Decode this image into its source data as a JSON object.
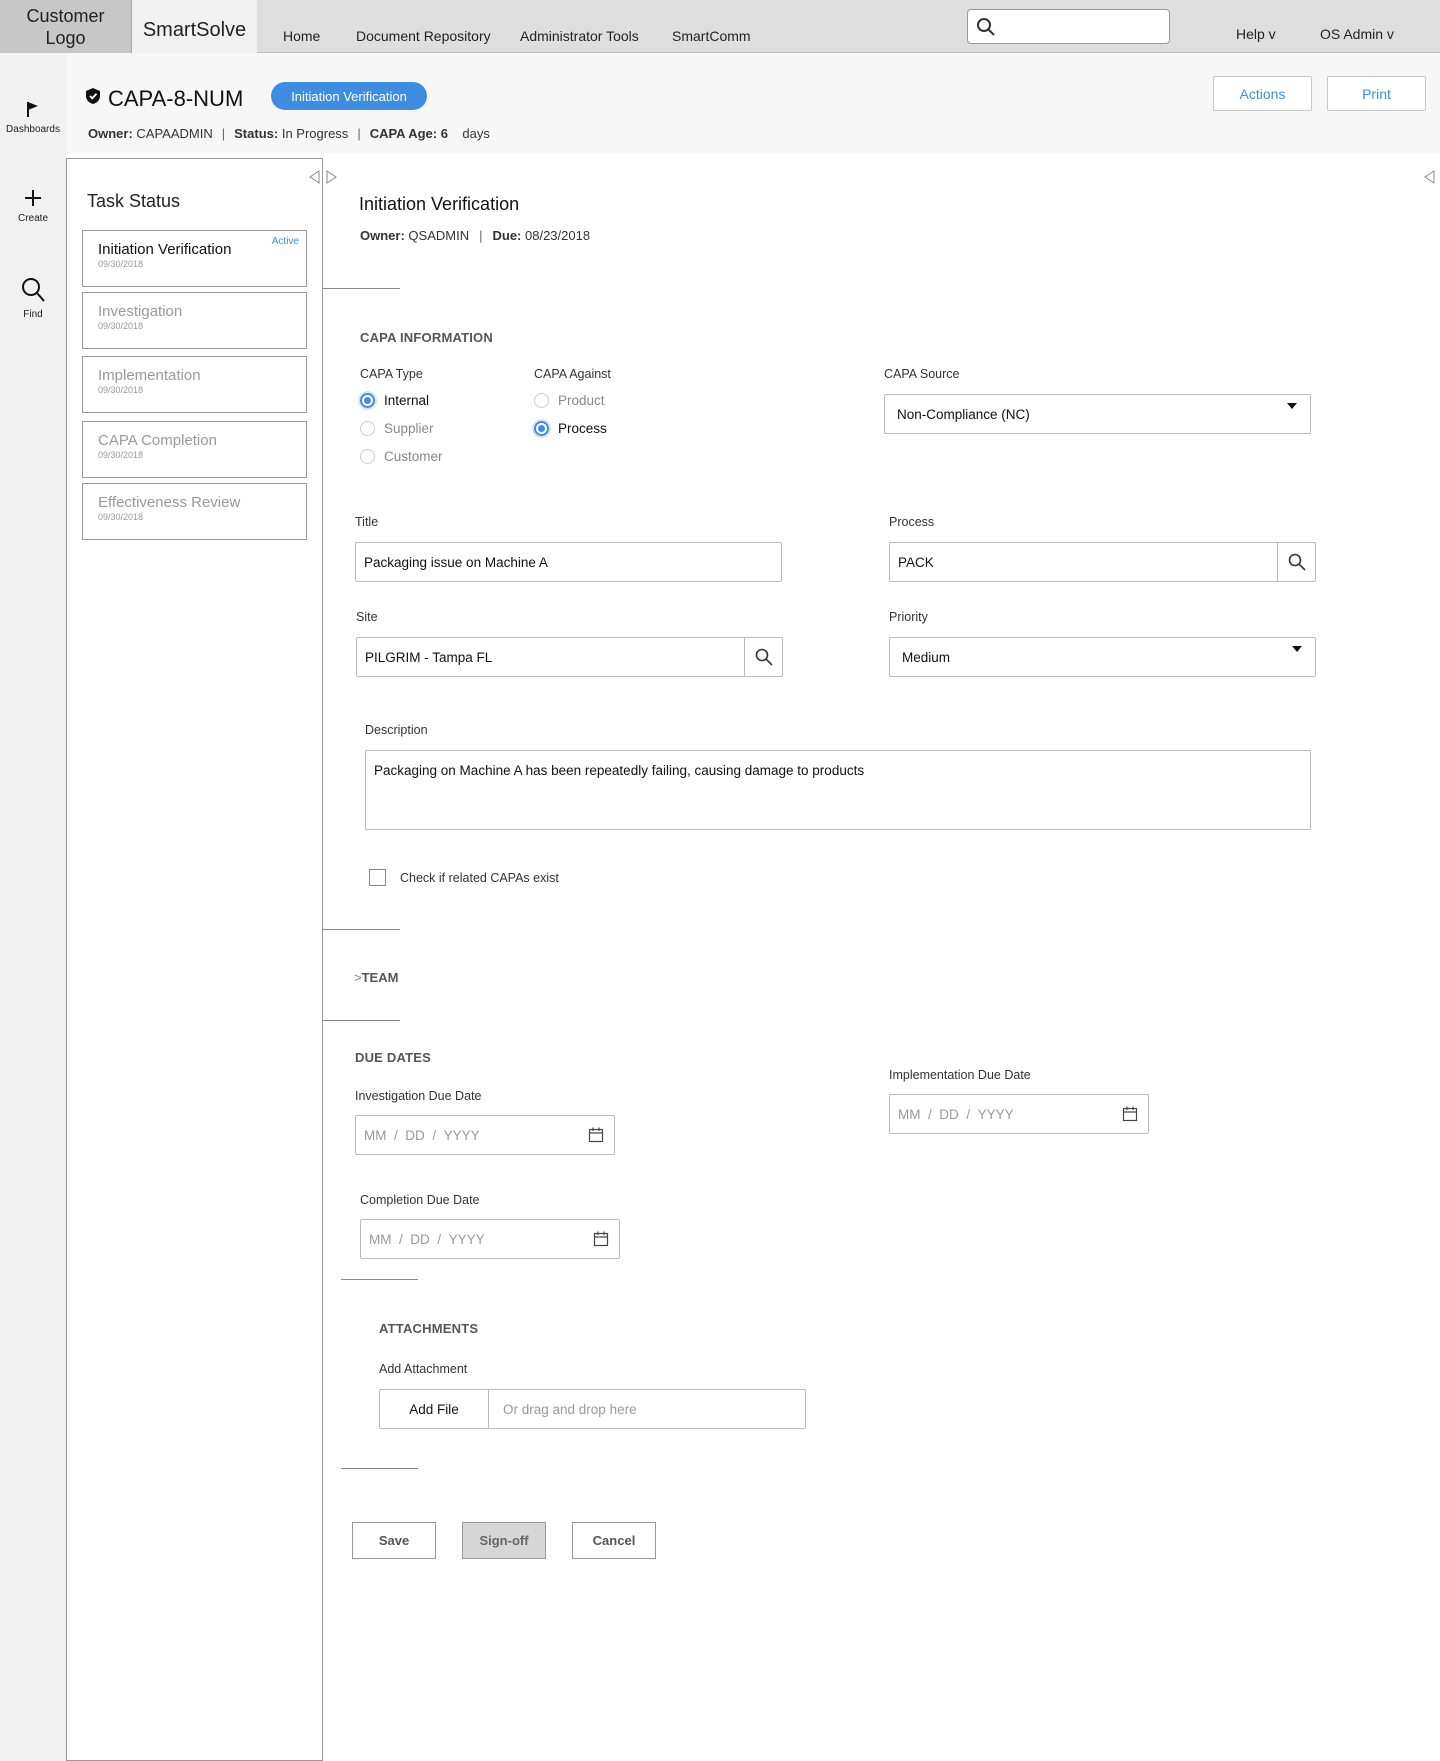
{
  "topbar": {
    "logo_line1": "Customer",
    "logo_line2": "Logo",
    "brand": "SmartSolve",
    "nav": [
      "Home",
      "Document Repository",
      "Administrator Tools",
      "SmartComm"
    ],
    "search_placeholder": "",
    "help": "Help v",
    "user": "OS Admin v"
  },
  "rail": {
    "items": [
      {
        "label": "Dashboards",
        "icon": "flag-icon"
      },
      {
        "label": "Create",
        "icon": "plus-icon"
      },
      {
        "label": "Find",
        "icon": "search-icon"
      }
    ]
  },
  "header": {
    "capa_id": "CAPA-8-NUM",
    "badge": "Initiation Verification",
    "owner_label": "Owner:",
    "owner": "CAPAADMIN",
    "status_label": "Status:",
    "status": "In Progress",
    "age_label": "CAPA Age:",
    "age": "6",
    "age_unit": "days",
    "actions_label": "Actions",
    "print_label": "Print",
    "accent_color": "#3f8de0"
  },
  "tasks": {
    "heading": "Task Status",
    "items": [
      {
        "name": "Initiation Verification",
        "date": "09/30/2018",
        "badge": "Active"
      },
      {
        "name": "Investigation",
        "date": "09/30/2018"
      },
      {
        "name": "Implementation",
        "date": "09/30/2018"
      },
      {
        "name": "CAPA Completion",
        "date": "09/30/2018"
      },
      {
        "name": "Effectiveness Review",
        "date": "09/30/2018"
      }
    ]
  },
  "main": {
    "title": "Initiation Verification",
    "owner_label": "Owner:",
    "owner": "QSADMIN",
    "due_label": "Due:",
    "due": "08/23/2018",
    "capa_info": {
      "heading": "CAPA INFORMATION",
      "type_label": "CAPA Type",
      "type_options": [
        "Internal",
        "Supplier",
        "Customer"
      ],
      "type_selected": "Internal",
      "against_label": "CAPA Against",
      "against_options": [
        "Product",
        "Process"
      ],
      "against_selected": "Process",
      "source_label": "CAPA Source",
      "source_value": "Non-Compliance (NC)",
      "title_label": "Title",
      "title_value": "Packaging issue on Machine A",
      "process_label": "Process",
      "process_value": "PACK",
      "site_label": "Site",
      "site_value": "PILGRIM - Tampa FL",
      "priority_label": "Priority",
      "priority_value": "Medium",
      "description_label": "Description",
      "description_value": "Packaging on Machine A has been repeatedly failing, causing damage to products",
      "related_label": "Check if related CAPAs exist"
    },
    "team": {
      "chevron": ">",
      "heading": "TEAM"
    },
    "due_dates": {
      "heading": "DUE DATES",
      "investigation_label": "Investigation Due Date",
      "implementation_label": "Implementation Due Date",
      "completion_label": "Completion Due Date",
      "placeholder_mm": "MM",
      "placeholder_dd": "DD",
      "placeholder_yyyy": "YYYY",
      "sep": "/"
    },
    "attachments": {
      "heading": "ATTACHMENTS",
      "add_label": "Add Attachment",
      "add_file": "Add File",
      "drop_text": "Or drag and drop here"
    },
    "buttons": {
      "save": "Save",
      "signoff": "Sign-off",
      "cancel": "Cancel"
    }
  }
}
